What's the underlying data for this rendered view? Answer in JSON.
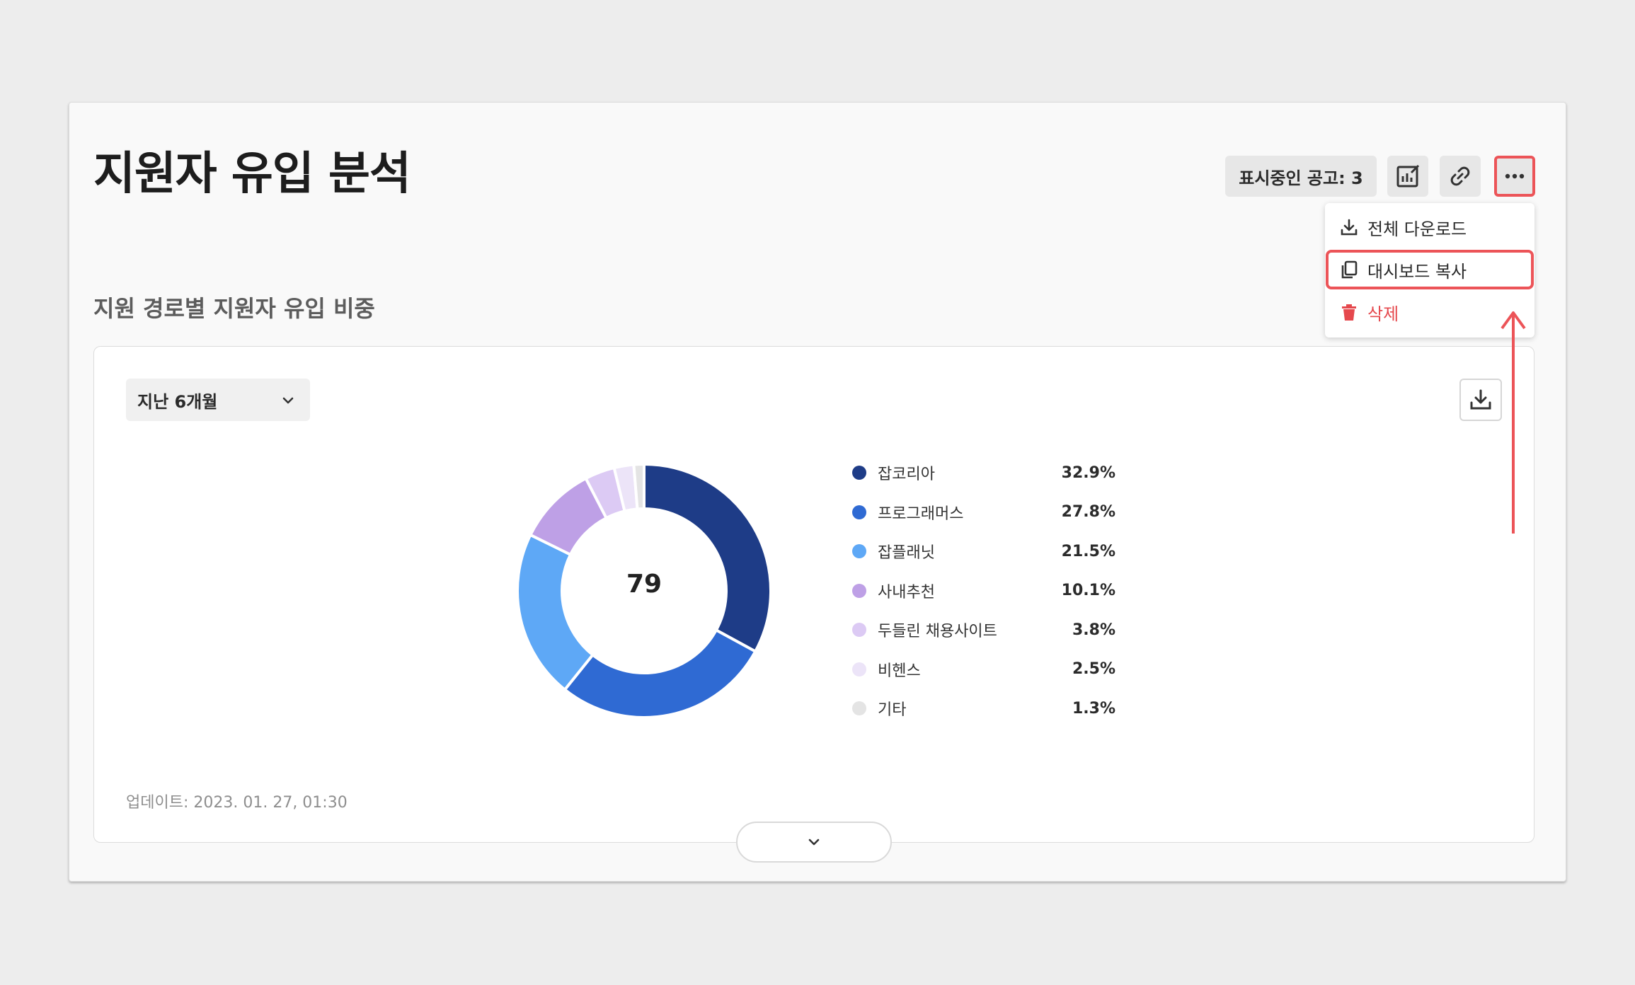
{
  "header": {
    "title": "지원자 유입 분석",
    "posting_count_label": "표시중인 공고: 3",
    "icons": [
      "report-edit-icon",
      "link-icon",
      "more-icon"
    ]
  },
  "more_menu": {
    "items": [
      {
        "label": "전체 다운로드",
        "icon": "download-icon"
      },
      {
        "label": "대시보드 복사",
        "icon": "copy-icon"
      },
      {
        "label": "삭제",
        "icon": "trash-icon",
        "color": "#e5484d"
      }
    ],
    "highlight_color": "#ec5458"
  },
  "section": {
    "title": "지원 경로별 지원자 유입 비중",
    "period": "지난 6개월",
    "updated": "업데이트: 2023. 01. 27, 01:30"
  },
  "chart_data": {
    "type": "pie",
    "center_label": "79",
    "categories": [
      "잡코리아",
      "프로그래머스",
      "잡플래닛",
      "사내추천",
      "두들린 채용사이트",
      "비헨스",
      "기타"
    ],
    "values": [
      32.9,
      27.8,
      21.5,
      10.1,
      3.8,
      2.5,
      1.3
    ],
    "value_labels": [
      "32.9%",
      "27.8%",
      "21.5%",
      "10.1%",
      "3.8%",
      "2.5%",
      "1.3%"
    ],
    "colors": [
      "#1e3c87",
      "#2f6ad3",
      "#5ea8f6",
      "#bea0e6",
      "#dccaf4",
      "#ece4f8",
      "#e4e4e4"
    ]
  }
}
